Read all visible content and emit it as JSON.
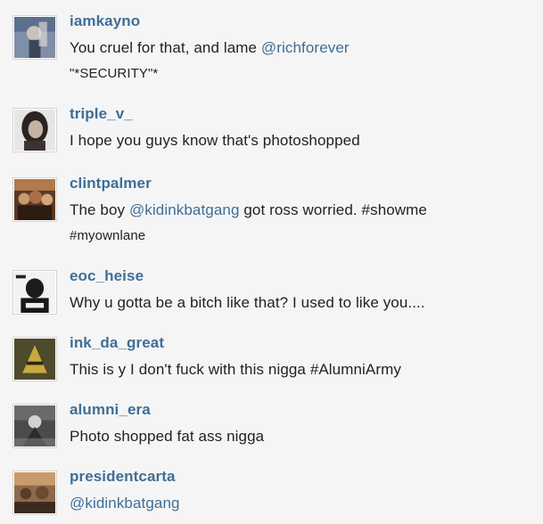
{
  "comments": [
    {
      "username": "iamkayno",
      "text_parts": [
        "You cruel for that, and lame ",
        "@richforever"
      ],
      "line2": "\"*SECURITY\"*",
      "avatar": "avatar-iamkayno"
    },
    {
      "username": "triple_v_",
      "text_parts": [
        "I hope you guys know that's photoshopped"
      ],
      "avatar": "avatar-triple-v"
    },
    {
      "username": "clintpalmer",
      "text_parts": [
        "The boy ",
        "@kidinkbatgang",
        " got ross worried. #showme"
      ],
      "line2": "#myownlane",
      "avatar": "avatar-clintpalmer"
    },
    {
      "username": "eoc_heise",
      "text_parts": [
        "Why u gotta be a bitch like that? I used to like you...."
      ],
      "avatar": "avatar-eoc-heise"
    },
    {
      "username": "ink_da_great",
      "text_parts": [
        "This is y I don't fuck with this nigga #AlumniArmy"
      ],
      "avatar": "avatar-ink-da-great"
    },
    {
      "username": "alumni_era",
      "text_parts": [
        "Photo shopped fat ass nigga"
      ],
      "avatar": "avatar-alumni-era"
    },
    {
      "username": "presidentcarta",
      "text_parts": [
        "@kidinkbatgang"
      ],
      "avatar": "avatar-presidentcarta"
    }
  ],
  "colors": {
    "background": "#f5f5f5",
    "username": "#3f6e97",
    "mention": "#3f6e97",
    "text": "#222222"
  }
}
